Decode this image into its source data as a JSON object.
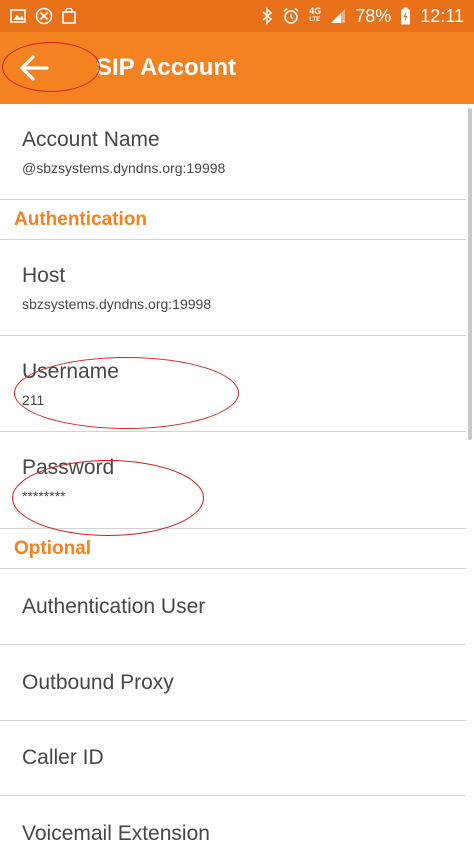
{
  "status_bar": {
    "network_small_top": "4G",
    "network_small_bottom": "LTE",
    "battery": "78%",
    "time": "12:11"
  },
  "app_bar": {
    "title": "SIP Account"
  },
  "account": {
    "title": "Account Name",
    "value": "@sbzsystems.dyndns.org:19998"
  },
  "sections": {
    "authentication": "Authentication",
    "optional": "Optional"
  },
  "auth": {
    "host_title": "Host",
    "host_value": "sbzsystems.dyndns.org:19998",
    "username_title": "Username",
    "username_value": "211",
    "password_title": "Password",
    "password_value": "********"
  },
  "optional": {
    "auth_user": "Authentication User",
    "outbound_proxy": "Outbound Proxy",
    "caller_id": "Caller ID",
    "voicemail_extension": "Voicemail Extension"
  },
  "colors": {
    "accent": "#f58220",
    "status_bar": "#e8711a",
    "annotation": "#d81e1e"
  }
}
